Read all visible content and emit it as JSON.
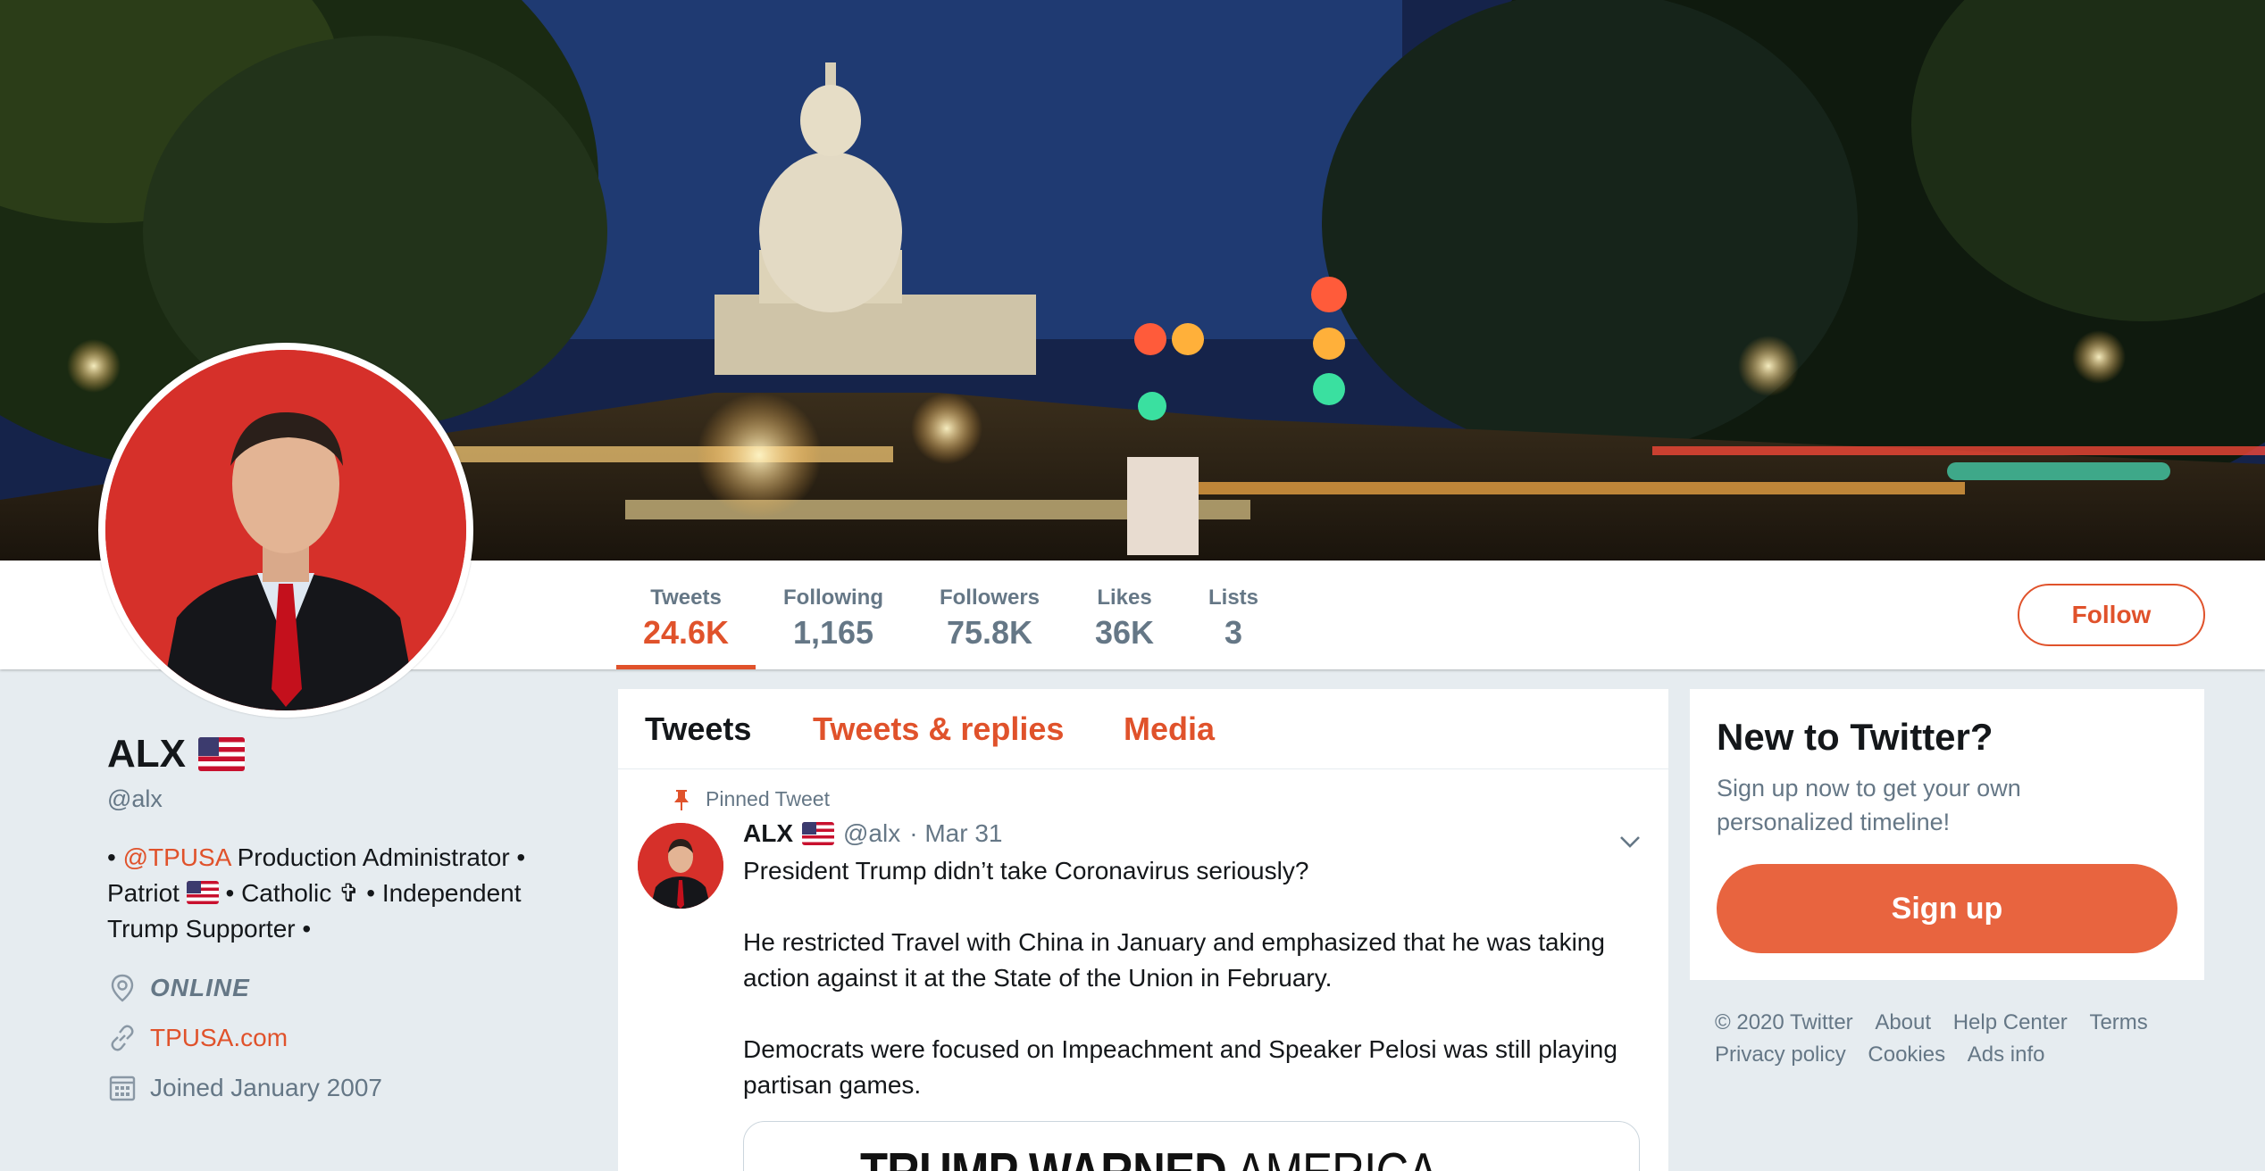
{
  "profile_nav": {
    "stats": [
      {
        "label": "Tweets",
        "value": "24.6K"
      },
      {
        "label": "Following",
        "value": "1,165"
      },
      {
        "label": "Followers",
        "value": "75.8K"
      },
      {
        "label": "Likes",
        "value": "36K"
      },
      {
        "label": "Lists",
        "value": "3"
      }
    ],
    "follow_label": "Follow"
  },
  "profile": {
    "name": "ALX",
    "handle": "@alx",
    "bio_prefix": "• ",
    "bio_mention": "@TPUSA",
    "bio_line1_rest": " Production Administrator •",
    "bio_line2_a": "Patriot ",
    "bio_line2_b": " • Catholic ✞ • Independent",
    "bio_line3": "Trump Supporter •",
    "location": "ONLINE",
    "website": "TPUSA.com",
    "joined": "Joined January 2007"
  },
  "timeline": {
    "tabs": [
      "Tweets",
      "Tweets & replies",
      "Media"
    ],
    "pinned_label": "Pinned Tweet",
    "tweet": {
      "name": "ALX",
      "handle": "@alx",
      "date": "· Mar 31",
      "text": "President Trump didn’t take Coronavirus seriously?\n\nHe restricted Travel with China in January and emphasized that he was taking action against it at the State of the Union in February.\n\nDemocrats were focused on Impeachment and Speaker Pelosi was still playing partisan games.",
      "card_headline_bold": "TRUMP WARNED",
      "card_headline_light": " AMERICA"
    }
  },
  "sidebar": {
    "title": "New to Twitter?",
    "subtitle": "Sign up now to get your own personalized timeline!",
    "signup_label": "Sign up",
    "footer_links": [
      "© 2020 Twitter",
      "About",
      "Help Center",
      "Terms",
      "Privacy policy",
      "Cookies",
      "Ads info"
    ]
  },
  "colors": {
    "accent": "#e0522b",
    "signup_button": "#e8643f",
    "background": "#e6ecf0",
    "muted_text": "#657786"
  },
  "icons": [
    "location-pin-icon",
    "link-icon",
    "calendar-icon",
    "pin-icon",
    "chevron-down-icon",
    "us-flag-icon"
  ]
}
